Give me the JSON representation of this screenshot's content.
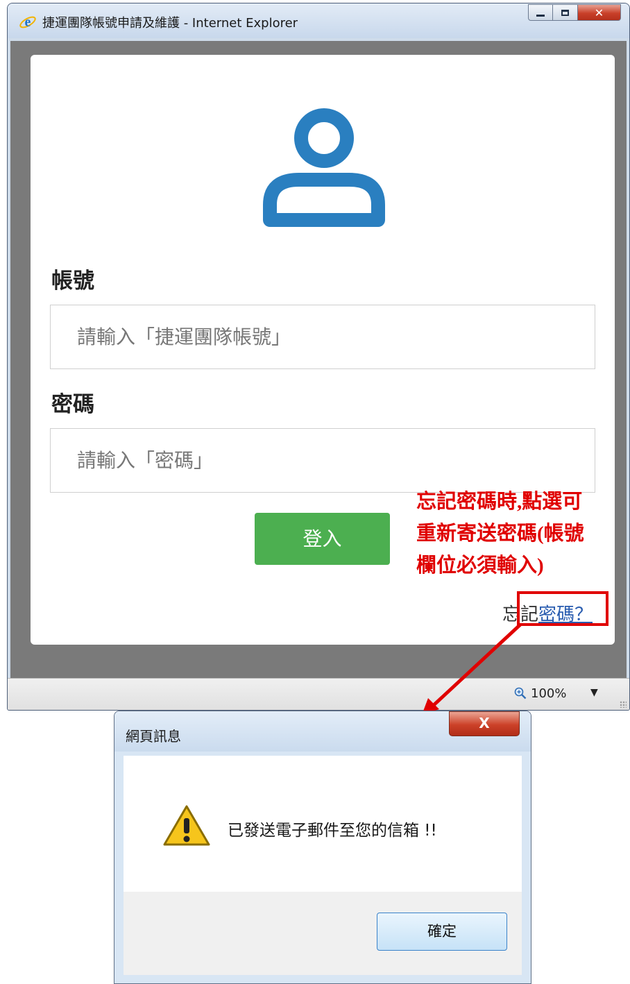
{
  "browser": {
    "title": "捷運團隊帳號申請及維護 - Internet Explorer",
    "zoom": "100%"
  },
  "login": {
    "account_label": "帳號",
    "account_placeholder": "請輸入「捷運團隊帳號」",
    "password_label": "密碼",
    "password_placeholder": "請輸入「密碼」",
    "login_button": "登入",
    "forgot_prefix": "忘記",
    "forgot_link": "密碼？"
  },
  "annotation": {
    "lines": [
      "忘記密碼時,點選可",
      "重新寄送密碼(帳號",
      "欄位必須輸入)"
    ]
  },
  "dialog": {
    "title": "網頁訊息",
    "close": "X",
    "message": "已發送電子郵件至您的信箱 !!",
    "ok_button": "確定"
  },
  "colors": {
    "accent_blue": "#2a7fc0",
    "login_green": "#4caf50",
    "annotation_red": "#e00000"
  },
  "icons": [
    "ie-logo-icon",
    "user-icon",
    "zoom-icon",
    "warning-icon"
  ]
}
